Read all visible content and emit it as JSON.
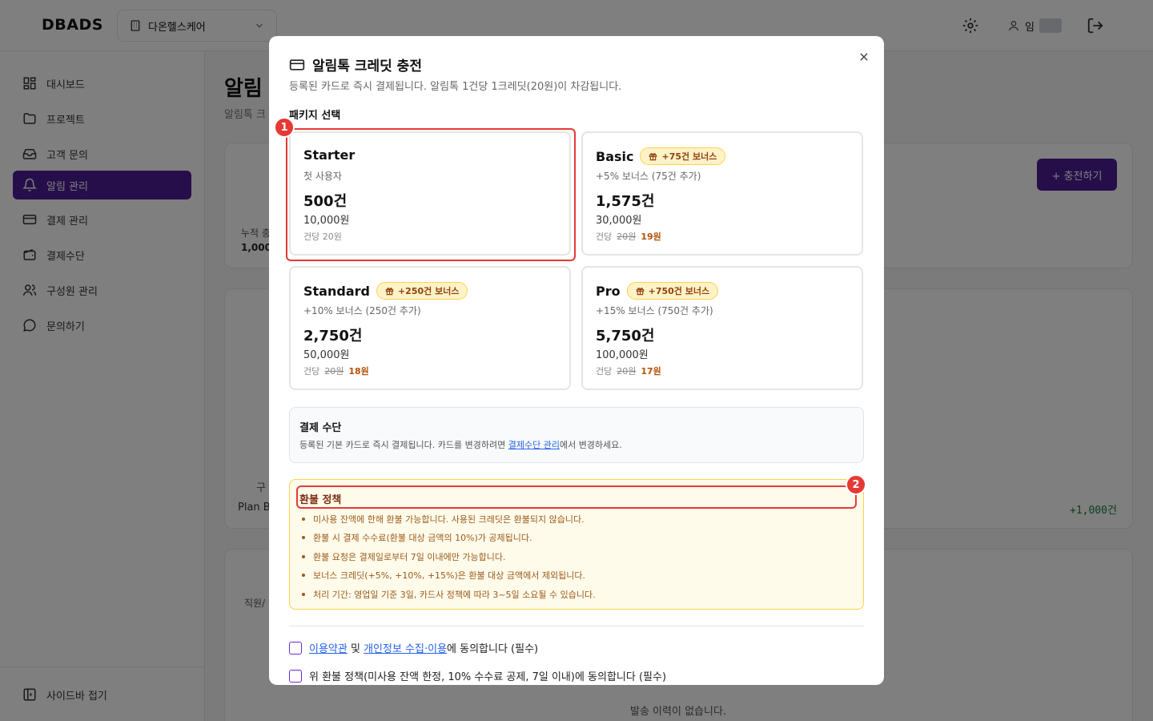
{
  "app": {
    "logo": "DBADS",
    "org": "다온헬스케어",
    "user_name": "임"
  },
  "sidebar": {
    "items": [
      {
        "label": "대시보드",
        "icon": "dashboard-icon"
      },
      {
        "label": "프로젝트",
        "icon": "folder-icon"
      },
      {
        "label": "고객 문의",
        "icon": "inbox-icon"
      },
      {
        "label": "알림 관리",
        "icon": "bell-icon",
        "active": true
      },
      {
        "label": "결제 관리",
        "icon": "credit-card-icon"
      },
      {
        "label": "결제수단",
        "icon": "wallet-icon"
      },
      {
        "label": "구성원 관리",
        "icon": "users-icon"
      },
      {
        "label": "문의하기",
        "icon": "chat-icon"
      }
    ],
    "collapse_label": "사이드바 접기"
  },
  "page": {
    "title": "알림",
    "subtitle": "알림톡 크",
    "charge_button": "+ 충전하기",
    "cumulative_label": "누적 충",
    "cumulative_value": "1,000건",
    "plan_label": "Plan B",
    "section_label": "구",
    "plus_amount": "+1,000건",
    "staff_label": "직원/",
    "empty_history": "발송 이력이 없습니다."
  },
  "modal": {
    "title": "알림톡 크레딧 충전",
    "description": "등록된 카드로 즉시 결제됩니다. 알림톡 1건당 1크레딧(20원)이 차감됩니다.",
    "package_label": "패키지 선택",
    "packages": [
      {
        "name": "Starter",
        "badge": "",
        "sub": "첫 사용자",
        "count": "500건",
        "price": "10,000원",
        "unit_label": "건당 20원",
        "orig_unit": "",
        "disc_unit": "",
        "selected": true
      },
      {
        "name": "Basic",
        "badge": "+75건 보너스",
        "sub": "+5% 보너스 (75건 추가)",
        "count": "1,575건",
        "price": "30,000원",
        "unit_label": "건당",
        "orig_unit": "20원",
        "disc_unit": "19원"
      },
      {
        "name": "Standard",
        "badge": "+250건 보너스",
        "sub": "+10% 보너스 (250건 추가)",
        "count": "2,750건",
        "price": "50,000원",
        "unit_label": "건당",
        "orig_unit": "20원",
        "disc_unit": "18원"
      },
      {
        "name": "Pro",
        "badge": "+750건 보너스",
        "sub": "+15% 보너스 (750건 추가)",
        "count": "5,750건",
        "price": "100,000원",
        "unit_label": "건당",
        "orig_unit": "20원",
        "disc_unit": "17원"
      }
    ],
    "payment": {
      "title": "결제 수단",
      "desc_before": "등록된 기본 카드로 즉시 결제됩니다. 카드를 변경하려면 ",
      "link": "결제수단 관리",
      "desc_after": "에서 변경하세요."
    },
    "refund": {
      "title": "환불 정책",
      "items": [
        "미사용 잔액에 한해 환불 가능합니다. 사용된 크레딧은 환불되지 않습니다.",
        "환불 시 결제 수수료(환불 대상 금액의 10%)가 공제됩니다.",
        "환불 요청은 결제일로부터 7일 이내에만 가능합니다.",
        "보너스 크레딧(+5%, +10%, +15%)은 환불 대상 금액에서 제외됩니다.",
        "처리 기간: 영업일 기준 3일, 카드사 정책에 따라 3~5일 소요될 수 있습니다."
      ]
    },
    "agree_terms": {
      "link1": "이용약관",
      "mid": " 및 ",
      "link2": "개인정보 수집·이용",
      "after": "에 동의합니다 (필수)"
    },
    "agree_refund": "위 환불 정책(미사용 잔액 한정, 10% 수수료 공제, 7일 이내)에 동의합니다 (필수)",
    "markers": [
      "1",
      "2"
    ]
  },
  "colors": {
    "brand": "#4c1d95",
    "highlight": "#e53935",
    "link": "#2563eb",
    "bonus": "#b45309"
  }
}
